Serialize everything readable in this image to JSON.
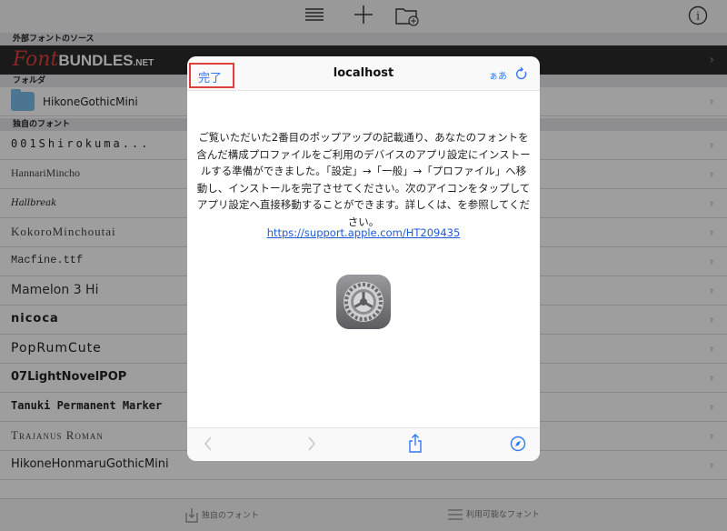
{
  "sections": {
    "external_source": "外部フォントのソース",
    "folders": "フォルダ",
    "own_fonts": "独自のフォント"
  },
  "brand": {
    "font": "Font",
    "bundles": "BUNDLES",
    "net": ".NET"
  },
  "folder_item": "HikoneGothicMini",
  "font_list": [
    "001Shirokuma...",
    "HannariMincho",
    "Hallbreak",
    "KokoroMinchoutai",
    "Macfine.ttf",
    "Mamelon 3 Hi",
    "nicoca",
    "PopRumCute",
    "07LightNovelPOP",
    "Tanuki Permanent Marker",
    "Trajanus Roman",
    "HikoneHonmaruGothicMini"
  ],
  "bottom_bar": {
    "own_fonts_tab": "独自のフォント",
    "available_fonts_tab": "利用可能なフォント"
  },
  "modal": {
    "done_label": "完了",
    "title": "localhost",
    "text_size_label": "ぁあ",
    "message": "ご覧いただいた2番目のポップアップの記載通り、あなたのフォントを含んだ構成プロファイルをご利用のデバイスのアプリ設定にインストールする準備ができました。「設定」→「一般」→「プロファイル」へ移動し、インストールを完了させてください。次のアイコンをタップしてアプリ設定へ直接移動することができます。詳しくは、を参照してください。",
    "link": "https://support.apple.com/HT209435"
  },
  "colors": {
    "accent": "#3478f6",
    "highlight": "#e0403a",
    "brand_bg": "#2b2b2b"
  },
  "icons": [
    "list-icon",
    "add-icon",
    "new-folder-icon",
    "info-icon",
    "reload-icon",
    "back-icon",
    "forward-icon",
    "share-icon",
    "compass-icon",
    "settings-app-icon"
  ]
}
